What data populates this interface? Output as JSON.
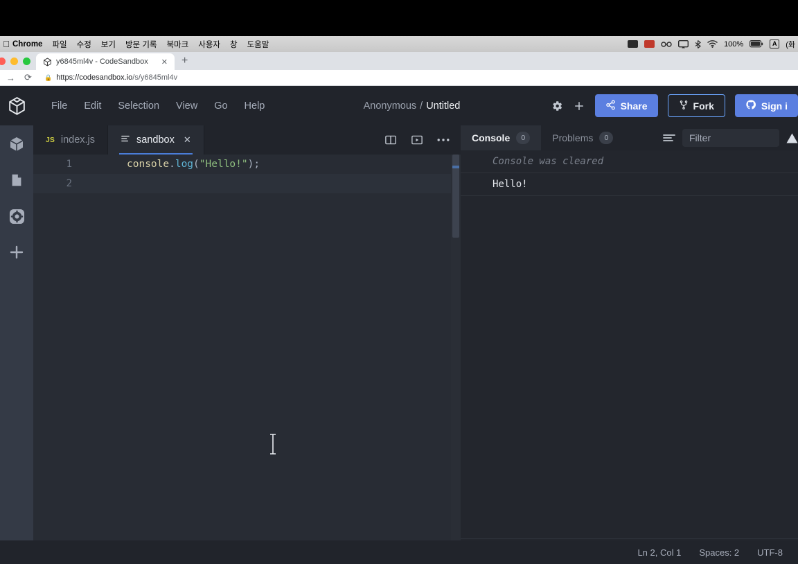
{
  "os_menubar": {
    "apple_icon": "apple-icon",
    "app_name": "Chrome",
    "menus": [
      "파일",
      "수정",
      "보기",
      "방문 기록",
      "북마크",
      "사용자",
      "창",
      "도움말"
    ],
    "status": {
      "screen_icon": "display-icon",
      "battery_box_icon": "recording-icon",
      "glasses_icon": "glasses-icon",
      "airplay_icon": "airplay-icon",
      "bluetooth_icon": "bluetooth-icon",
      "wifi_icon": "wifi-icon",
      "battery_percent": "100%",
      "battery_icon": "battery-icon",
      "input_source": "A",
      "datetime": "(화"
    }
  },
  "browser": {
    "tab": {
      "favicon": "codesandbox-favicon",
      "title": "y6845ml4v - CodeSandbox",
      "close_icon": "close-icon"
    },
    "new_tab_icon": "plus-icon",
    "nav": {
      "forward_icon": "forward-arrow-icon",
      "reload_icon": "reload-icon",
      "lock_icon": "lock-icon"
    },
    "url_domain": "https://codesandbox.io",
    "url_path": "/s/y6845ml4v"
  },
  "app": {
    "logo_icon": "codesandbox-cube-icon",
    "menus": [
      "File",
      "Edit",
      "Selection",
      "View",
      "Go",
      "Help"
    ],
    "workspace": {
      "owner": "Anonymous",
      "separator": "/",
      "sandbox_name": "Untitled"
    },
    "actions": {
      "settings_icon": "gear-icon",
      "new_icon": "plus-icon",
      "share_label": "Share",
      "share_icon": "share-icon",
      "fork_label": "Fork",
      "fork_icon": "fork-icon",
      "signin_label": "Sign i",
      "signin_icon": "github-icon"
    },
    "accent_color": "#5b7fe0",
    "fork_border_color": "#6ba6ff"
  },
  "activity_bar": {
    "items": [
      {
        "icon": "cube-icon",
        "name": "explorer"
      },
      {
        "icon": "file-icon",
        "name": "files"
      },
      {
        "icon": "gear-icon",
        "name": "settings"
      },
      {
        "icon": "plus-icon",
        "name": "add"
      }
    ]
  },
  "editor": {
    "tabs": [
      {
        "label": "index.js",
        "icon": "js-icon",
        "icon_label": "JS",
        "active": false,
        "closable": false
      },
      {
        "label": "sandbox",
        "icon": "config-icon",
        "active": true,
        "closable": true,
        "close_icon": "close-icon"
      }
    ],
    "tab_actions": [
      {
        "icon": "split-pane-icon",
        "name": "split-editor"
      },
      {
        "icon": "preview-icon",
        "name": "open-preview"
      },
      {
        "icon": "more-icon",
        "name": "more-options"
      }
    ],
    "lines": [
      {
        "number": "1",
        "active": false,
        "tokens": [
          {
            "text": "console",
            "type": "var"
          },
          {
            "text": ".",
            "type": "dot"
          },
          {
            "text": "log",
            "type": "fn"
          },
          {
            "text": "(",
            "type": "paren"
          },
          {
            "text": "\"Hello!\"",
            "type": "str"
          },
          {
            "text": ")",
            "type": "paren"
          },
          {
            "text": ";",
            "type": "paren"
          }
        ]
      },
      {
        "number": "2",
        "active": true,
        "tokens": []
      }
    ],
    "cursor_icon": "text-cursor-icon"
  },
  "console": {
    "tabs": [
      {
        "label": "Console",
        "badge": "0",
        "active": true
      },
      {
        "label": "Problems",
        "badge": "0",
        "active": false
      }
    ],
    "filter_icon": "filter-lines-icon",
    "filter_placeholder": "Filter",
    "warning_icon": "warning-icon",
    "messages": [
      {
        "text": "Console was cleared",
        "style": "cleared"
      },
      {
        "text": "Hello!",
        "style": "log"
      }
    ],
    "prompt_symbol": ">"
  },
  "status_bar": {
    "items": [
      "Ln 2, Col 1",
      "Spaces: 2",
      "UTF-8"
    ]
  }
}
